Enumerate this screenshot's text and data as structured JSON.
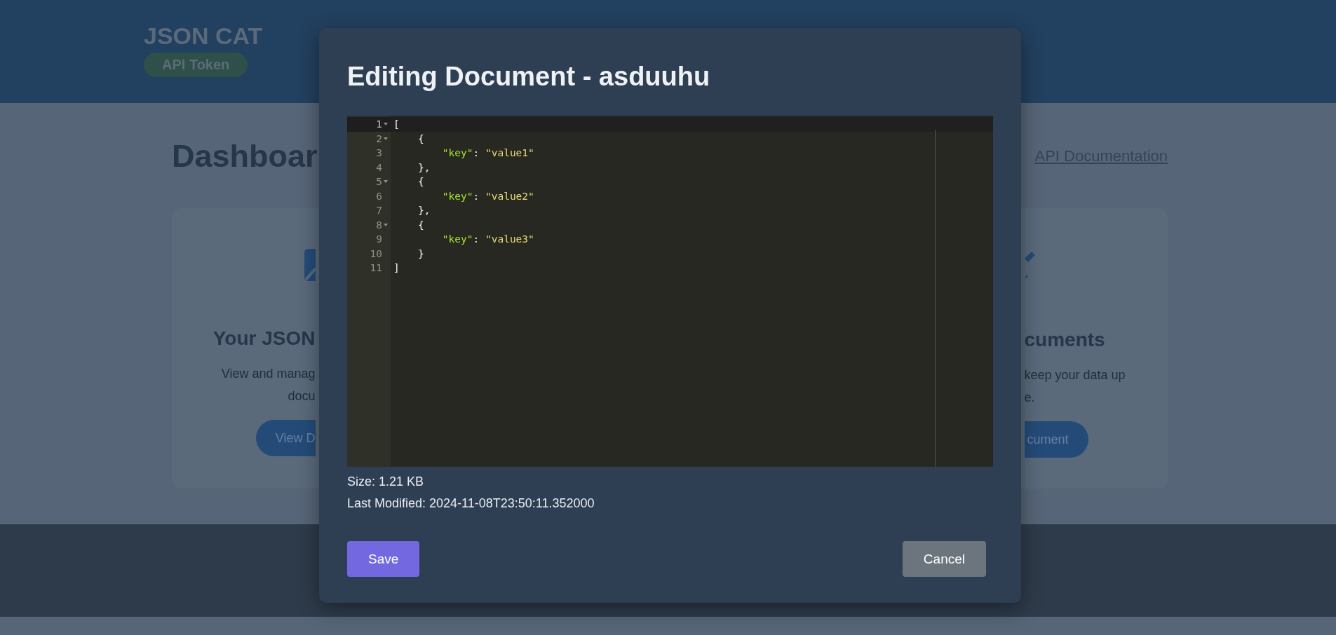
{
  "header": {
    "title": "JSON CAT",
    "token_badge": "API Token"
  },
  "dashboard": {
    "title": "Dashboar",
    "link": "API Documentation"
  },
  "cards": [
    {
      "kind": "left",
      "heading": "Your JSON",
      "description_lines": [
        "View and manag",
        "docu"
      ],
      "button": "View D"
    },
    {
      "kind": "right",
      "heading": "cuments",
      "description_lines": [
        "keep your data up",
        "e."
      ],
      "button": "cument"
    }
  ],
  "modal": {
    "title": "Editing Document - asduuhu",
    "editor": {
      "lines": [
        {
          "number": "1",
          "foldable": true,
          "active": true,
          "tokens": [
            {
              "kind": "punct",
              "text": "["
            }
          ]
        },
        {
          "number": "2",
          "foldable": true,
          "active": false,
          "tokens": [
            {
              "kind": "punct",
              "text": "    {"
            }
          ]
        },
        {
          "number": "3",
          "foldable": false,
          "active": false,
          "tokens": [
            {
              "kind": "key",
              "text": "        \"key\""
            },
            {
              "kind": "punct",
              "text": ": "
            },
            {
              "kind": "string",
              "text": "\"value1\""
            }
          ]
        },
        {
          "number": "4",
          "foldable": false,
          "active": false,
          "tokens": [
            {
              "kind": "punct",
              "text": "    },"
            }
          ]
        },
        {
          "number": "5",
          "foldable": true,
          "active": false,
          "tokens": [
            {
              "kind": "punct",
              "text": "    {"
            }
          ]
        },
        {
          "number": "6",
          "foldable": false,
          "active": false,
          "tokens": [
            {
              "kind": "key",
              "text": "        \"key\""
            },
            {
              "kind": "punct",
              "text": ": "
            },
            {
              "kind": "string",
              "text": "\"value2\""
            }
          ]
        },
        {
          "number": "7",
          "foldable": false,
          "active": false,
          "tokens": [
            {
              "kind": "punct",
              "text": "    },"
            }
          ]
        },
        {
          "number": "8",
          "foldable": true,
          "active": false,
          "tokens": [
            {
              "kind": "punct",
              "text": "    {"
            }
          ]
        },
        {
          "number": "9",
          "foldable": false,
          "active": false,
          "tokens": [
            {
              "kind": "key",
              "text": "        \"key\""
            },
            {
              "kind": "punct",
              "text": ": "
            },
            {
              "kind": "string",
              "text": "\"value3\""
            }
          ]
        },
        {
          "number": "10",
          "foldable": false,
          "active": false,
          "tokens": [
            {
              "kind": "punct",
              "text": "    }"
            }
          ]
        },
        {
          "number": "11",
          "foldable": false,
          "active": false,
          "tokens": [
            {
              "kind": "punct",
              "text": "]"
            }
          ]
        }
      ]
    },
    "size": "Size: 1.21 KB",
    "last_modified": "Last Modified: 2024-11-08T23:50:11.352000",
    "buttons": [
      {
        "kind": "primary",
        "label": "Save"
      },
      {
        "kind": "secondary",
        "label": "Cancel"
      }
    ]
  }
}
